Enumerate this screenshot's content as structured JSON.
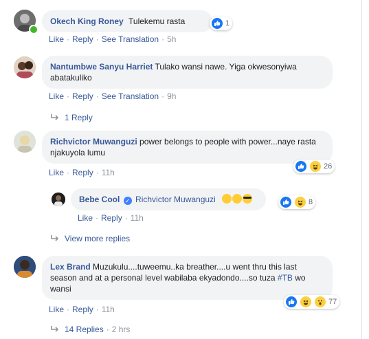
{
  "actions": {
    "like": "Like",
    "reply": "Reply",
    "see_translation": "See Translation"
  },
  "comments": [
    {
      "author": "Okech King Roney",
      "text": "Tulekemu rasta",
      "reactions": "1",
      "time": "5h"
    },
    {
      "author": "Nantumbwe Sanyu Harriet",
      "text": "Tulako wansi nawe. Yiga okwesonyiwa abatakuliko",
      "time": "9h",
      "replies_link": "1 Reply"
    },
    {
      "author": "Richvictor Muwanguzi",
      "text": "power belongs to people with power...naye rasta njakuyola lumu",
      "reactions": "26",
      "time": "11h",
      "reply": {
        "author": "Bebe Cool",
        "mention": "Richvictor Muwanguzi",
        "reactions": "8",
        "time": "11h"
      },
      "replies_link": "View more replies"
    },
    {
      "author": "Lex Brand",
      "text_before": "Muzukulu....tuweemu..ka breather....u went thru this last season and at a personal level wabilaba ekyadondo....so tuza ",
      "hashtag": "#TB",
      "text_after": " wo wansi",
      "reactions": "77",
      "time": "11h",
      "time2": "2 hrs",
      "replies_link": "14 Replies"
    }
  ],
  "colors": {
    "link": "#385898",
    "bubble": "#f2f3f5",
    "meta": "#90949c",
    "like": "#1877f2",
    "online": "#42b72a"
  }
}
